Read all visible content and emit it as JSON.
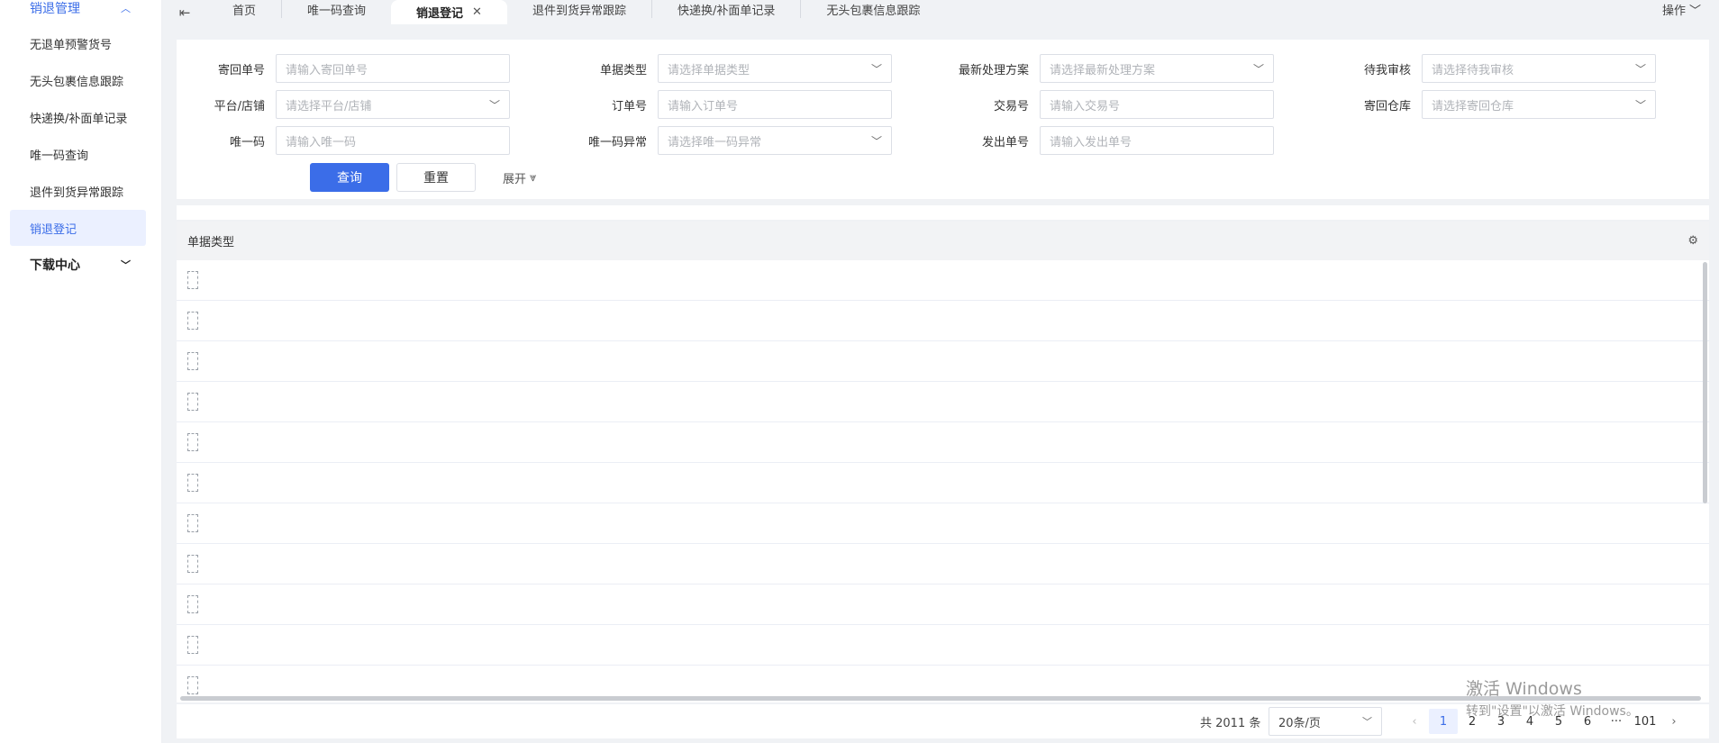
{
  "sidebar": {
    "group": "销退管理",
    "items": [
      {
        "label": "无退单预警货号"
      },
      {
        "label": "无头包裹信息跟踪"
      },
      {
        "label": "快递换/补面单记录"
      },
      {
        "label": "唯一码查询"
      },
      {
        "label": "退件到货异常跟踪"
      },
      {
        "label": "销退登记"
      }
    ],
    "group2": "下载中心"
  },
  "tabs": [
    {
      "label": "首页"
    },
    {
      "label": "唯一码查询"
    },
    {
      "label": "销退登记"
    },
    {
      "label": "退件到货异常跟踪"
    },
    {
      "label": "快递换/补面单记录"
    },
    {
      "label": "无头包裹信息跟踪"
    }
  ],
  "ops_label": "操作",
  "filters": {
    "return_no": {
      "label": "寄回单号",
      "placeholder": "请输入寄回单号"
    },
    "doc_type": {
      "label": "单据类型",
      "placeholder": "请选择单据类型"
    },
    "latest_plan": {
      "label": "最新处理方案",
      "placeholder": "请选择最新处理方案"
    },
    "my_review": {
      "label": "待我审核",
      "placeholder": "请选择待我审核"
    },
    "platform": {
      "label": "平台/店铺",
      "placeholder": "请选择平台/店铺"
    },
    "order_no": {
      "label": "订单号",
      "placeholder": "请输入订单号"
    },
    "trade_no": {
      "label": "交易号",
      "placeholder": "请输入交易号"
    },
    "warehouse": {
      "label": "寄回仓库",
      "placeholder": "请选择寄回仓库"
    },
    "unique_code": {
      "label": "唯一码",
      "placeholder": "请输入唯一码"
    },
    "code_exception": {
      "label": "唯一码异常",
      "placeholder": "请选择唯一码异常"
    },
    "ship_no": {
      "label": "发出单号",
      "placeholder": "请输入发出单号"
    }
  },
  "buttons": {
    "query": "查询",
    "reset": "重置",
    "expand": "展开"
  },
  "table": {
    "header": "单据类型",
    "rows": 11
  },
  "pagination": {
    "total": "共 2011 条",
    "page_size": "20条/页",
    "pages": [
      "1",
      "2",
      "3",
      "4",
      "5",
      "6",
      "···",
      "101"
    ]
  },
  "watermark": {
    "line1": "激活 Windows",
    "line2": "转到\"设置\"以激活 Windows。"
  },
  "colors": {
    "accent": "#3b6de8",
    "active_bg": "#ebf0ff"
  }
}
